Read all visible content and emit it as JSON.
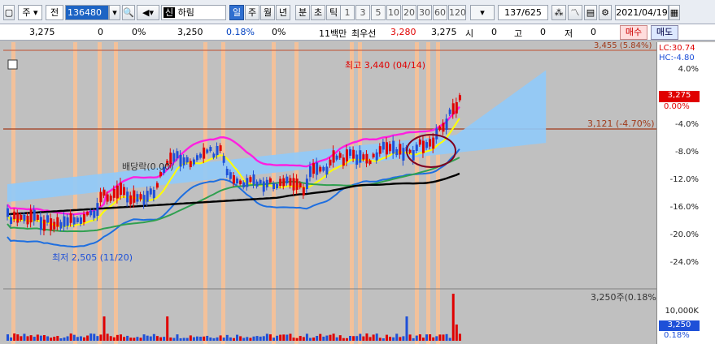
{
  "toolbar": {
    "market": "주",
    "type": "전",
    "code": "136480",
    "name_badge": "신",
    "name": "하림",
    "periods": [
      "일",
      "주",
      "월",
      "년",
      "분",
      "초",
      "틱"
    ],
    "active_period": "일",
    "minutes": [
      "1",
      "3",
      "5",
      "10",
      "20",
      "30",
      "60",
      "120"
    ],
    "count": "137/625",
    "date": "2021/04/19"
  },
  "info": {
    "price": "3,275",
    "change": "0",
    "change_pct": "0%",
    "prev": "3,250",
    "pct2": "0.18%",
    "pct3": "0%",
    "unit": "11백만",
    "best_bid_label": "최우선",
    "best_bid": "3,280",
    "last": "3,275",
    "open_label": "시",
    "open": "0",
    "high_label": "고",
    "high": "0",
    "low_label": "저",
    "low": "0",
    "buy_label": "매수",
    "sell_label": "매도"
  },
  "chart_data": {
    "type": "candlestick",
    "annotations": {
      "high": "최고 3,440 (04/14)",
      "low": "최저 2,505 (11/20)",
      "guide": "3,121 (-4.70%)",
      "top_line": "3,455 (5.84%)",
      "lc": "LC:30.74",
      "hc": "HC:-4.80",
      "series_label": "배당락(0.00)",
      "current_price": "3,275",
      "current_pct": "0.00%",
      "volume_info": "3,250주(0.18%)",
      "volume_scale": "10,000K",
      "volume_price": "3,250",
      "volume_pct": "0.18%"
    },
    "y_axis_labels": [
      "4.0%",
      "0.00%",
      "-4.0%",
      "-8.0%",
      "-12.0%",
      "-16.0%",
      "-20.0%",
      "-24.0%"
    ],
    "price_range": [
      2505,
      3440
    ],
    "colors": {
      "up": "#e00000",
      "down": "#1e50d8",
      "ma_magenta": "#ff20e0",
      "ma_yellow": "#ffff00",
      "ma_green": "#30a050",
      "ma_black": "#000000",
      "cloud": "#90caf9",
      "band_blue": "#1e6fe0",
      "highlight": "#ffc090"
    }
  }
}
